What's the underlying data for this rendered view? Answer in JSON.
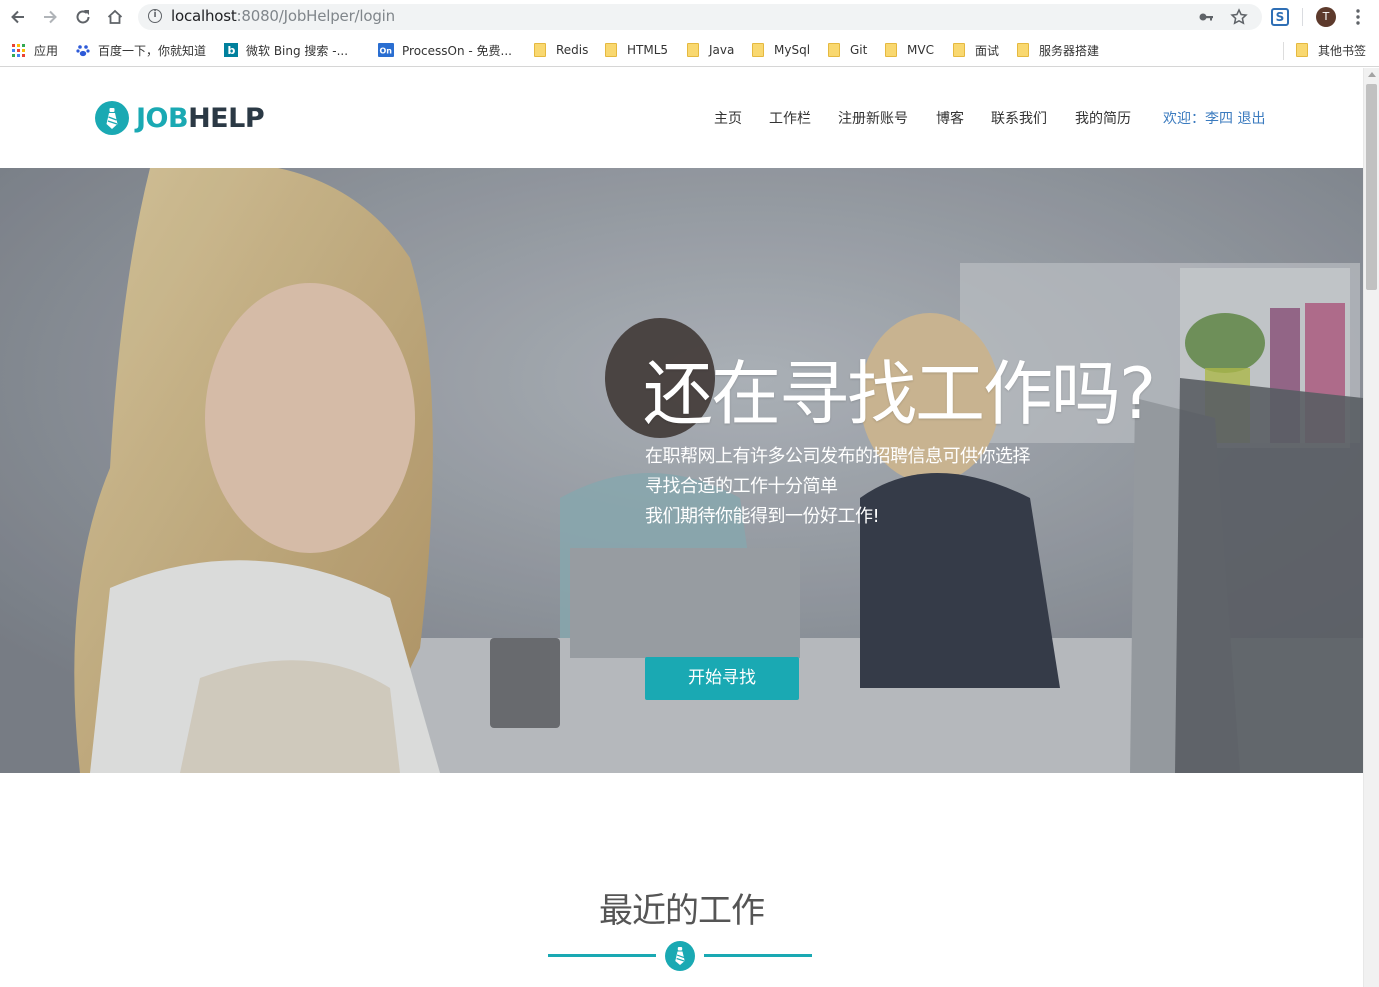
{
  "browser": {
    "url_host": "localhost",
    "url_rest": ":8080/JobHelper/login",
    "profile_initial": "T",
    "bookmarks": [
      {
        "label": "应用"
      },
      {
        "label": "百度一下，你就知道"
      },
      {
        "label": "微软 Bing 搜索 -..."
      },
      {
        "label": "ProcessOn - 免费..."
      },
      {
        "label": "Redis"
      },
      {
        "label": "HTML5"
      },
      {
        "label": "Java"
      },
      {
        "label": "MySql"
      },
      {
        "label": "Git"
      },
      {
        "label": "MVC"
      },
      {
        "label": "面试"
      },
      {
        "label": "服务器搭建"
      },
      {
        "label": "其他书签"
      }
    ]
  },
  "site": {
    "logo_part1": "JOB",
    "logo_part2": "HELP",
    "brand_color": "#1aa9b3",
    "nav": [
      {
        "label": "主页"
      },
      {
        "label": "工作栏"
      },
      {
        "label": "注册新账号"
      },
      {
        "label": "博客"
      },
      {
        "label": "联系我们"
      },
      {
        "label": "我的简历"
      }
    ],
    "welcome": "欢迎：李四 退出"
  },
  "hero": {
    "title": "还在寻找工作吗?",
    "lines": [
      "在职帮网上有许多公司发布的招聘信息可供你选择",
      "寻找合适的工作十分简单",
      "我们期待你能得到一份好工作!"
    ],
    "button": "开始寻找"
  },
  "recent": {
    "title": "最近的工作"
  }
}
